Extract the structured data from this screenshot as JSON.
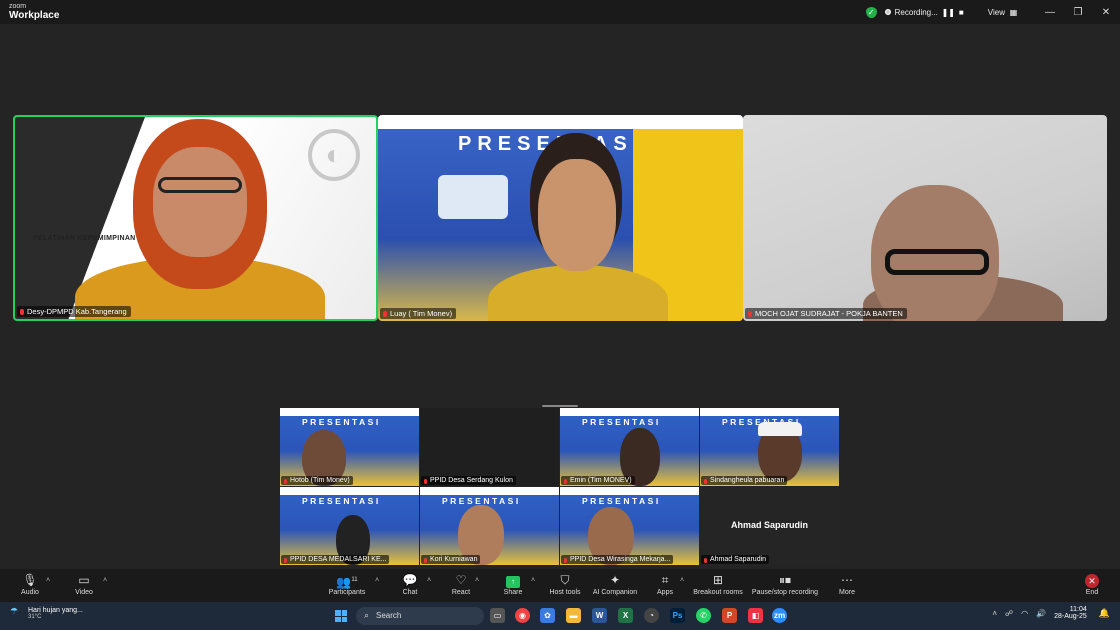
{
  "app": {
    "brand_small": "zoom",
    "brand_title": "Workplace"
  },
  "titlebar": {
    "recording_label": "Recording...",
    "view_label": "View"
  },
  "main_tiles": [
    {
      "name": "Desy-DPMPD Kab.Tangerang",
      "slide_text": "PELATIHAN KEPEMIMPINAN ADM"
    },
    {
      "name": "Luay ( Tim Monev)",
      "slide_text": "PRESENTASI"
    },
    {
      "name": "MOCH OJAT SUDRAJAT - POKJA BANTEN"
    }
  ],
  "gallery": [
    {
      "name": "Hotob (Tim Monev)",
      "slide": "PRESENTASI"
    },
    {
      "name": "PPID Desa Serdang Kulon"
    },
    {
      "name": "Emin (Tim MONEV)",
      "slide": "PRESENTASI"
    },
    {
      "name": "Sindangheula pabuaran",
      "slide": "PRESENTASI"
    },
    {
      "name": "PPID DESA MEDALSARI KE...",
      "slide": "PRESENTASI"
    },
    {
      "name": "Kori Kurniawan",
      "slide": "PRESENTASI"
    },
    {
      "name": "PPID  Desa Wirasinga Mekarja...",
      "slide": "PRESENTASI"
    },
    {
      "name": "Ahmad Saparudin",
      "display": "Ahmad Saparudin"
    }
  ],
  "toolbar": {
    "audio": "Audio",
    "video": "Video",
    "participants": "Participants",
    "participants_count": "11",
    "chat": "Chat",
    "react": "React",
    "share": "Share",
    "host_tools": "Host tools",
    "ai_companion": "AI Companion",
    "apps": "Apps",
    "breakout": "Breakout rooms",
    "pause_rec": "Pause/stop recording",
    "more": "More",
    "end": "End"
  },
  "taskbar": {
    "weather_text": "Hari hujan yang...",
    "weather_temp": "31°C",
    "search_placeholder": "Search",
    "time": "11:04",
    "date": "28-Aug-25"
  },
  "colors": {
    "active_speaker": "#23d160",
    "end_red": "#c0262d",
    "share_green": "#22c55e"
  }
}
